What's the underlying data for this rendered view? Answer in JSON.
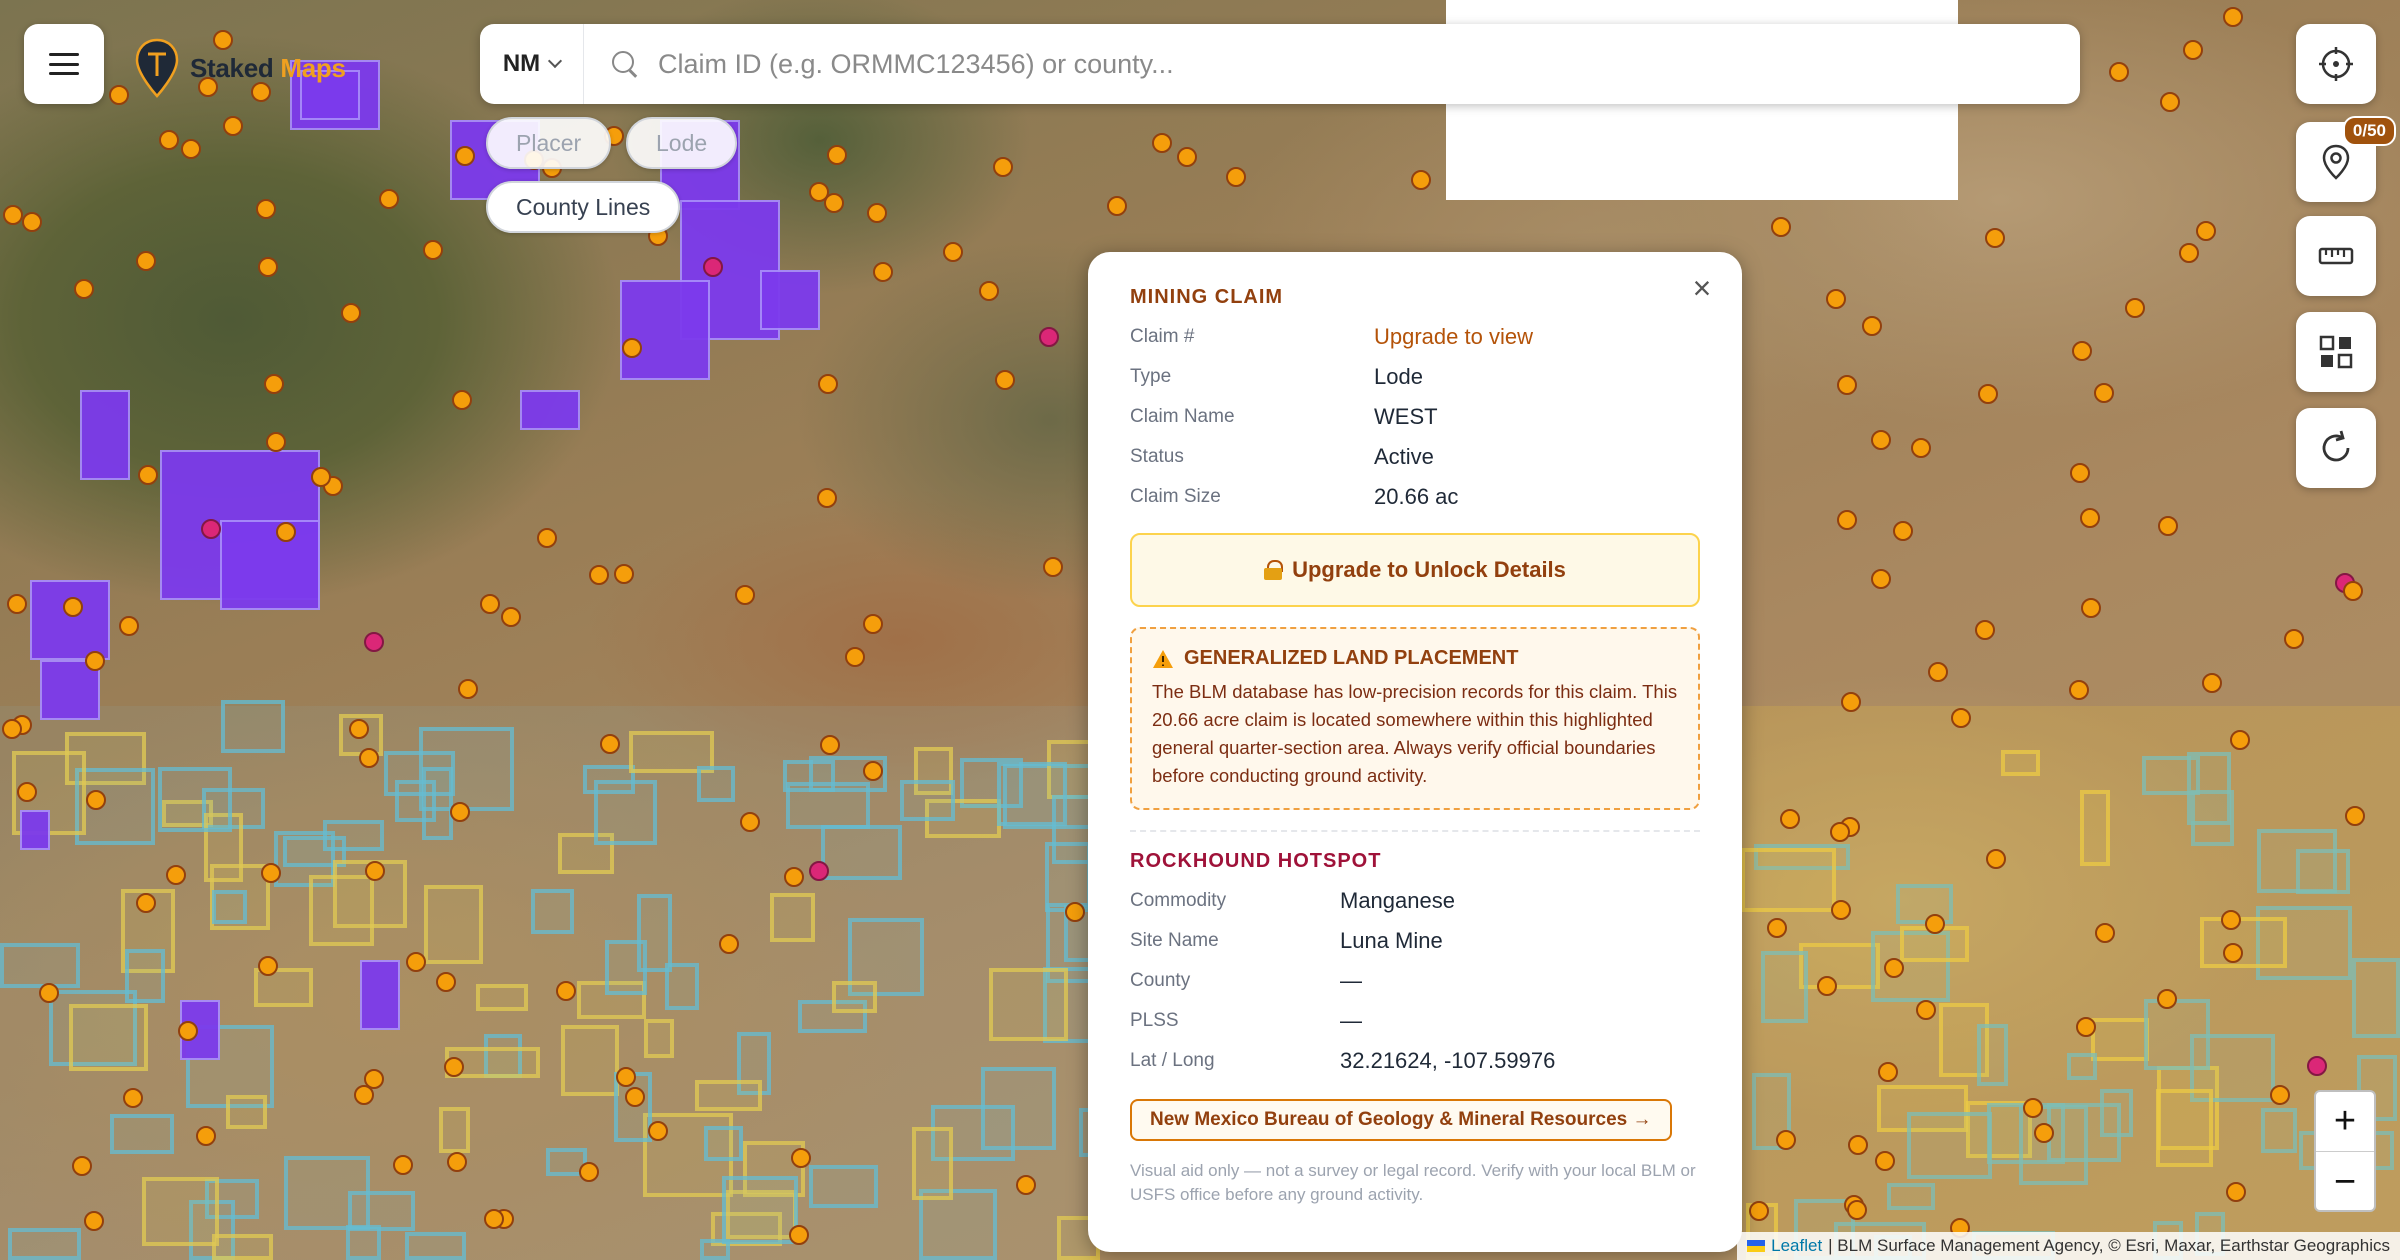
{
  "app": {
    "logo_text_a": "Staked",
    "logo_text_b": "Maps"
  },
  "search": {
    "state": "NM",
    "placeholder": "Claim ID (e.g. ORMMC123456) or county..."
  },
  "layers": {
    "placer": "Placer",
    "lode": "Lode",
    "county_lines": "County Lines"
  },
  "toolbar": {
    "pins_badge": "0/50"
  },
  "zoom": {
    "in": "+",
    "out": "−"
  },
  "attribution": {
    "leaflet": "Leaflet",
    "text": "| BLM Surface Management Agency, © Esri, Maxar, Earthstar Geographics"
  },
  "popup": {
    "close": "×",
    "claim_section": "MINING CLAIM",
    "claim_rows": [
      {
        "k": "Claim #",
        "v": "Upgrade to view"
      },
      {
        "k": "Type",
        "v": "Lode"
      },
      {
        "k": "Claim Name",
        "v": "WEST"
      },
      {
        "k": "Status",
        "v": "Active"
      },
      {
        "k": "Claim Size",
        "v": "20.66 ac"
      }
    ],
    "unlock_label": "Upgrade to Unlock Details",
    "warning_title": "GENERALIZED LAND PLACEMENT",
    "warning_text": "The BLM database has low-precision records for this claim. This 20.66 acre claim is located somewhere within this highlighted general quarter-section area. Always verify official boundaries before conducting ground activity.",
    "hotspot_section": "ROCKHOUND HOTSPOT",
    "hotspot_rows": [
      {
        "k": "Commodity",
        "v": "Manganese"
      },
      {
        "k": "Site Name",
        "v": "Luna Mine"
      },
      {
        "k": "County",
        "v": "—"
      },
      {
        "k": "PLSS",
        "v": "—"
      },
      {
        "k": "Lat / Long",
        "v": "32.21624, -107.59976"
      }
    ],
    "ngmr_link": "New Mexico Bureau of Geology & Mineral Resources →",
    "disclaimer": "Visual aid only — not a survey or legal record. Verify with your local BLM or USFS office before any ground activity."
  },
  "colors": {
    "claim_purple": "#7c3aed",
    "hotspot_orange": "#f59e0b",
    "accent_brown": "#92400e"
  }
}
